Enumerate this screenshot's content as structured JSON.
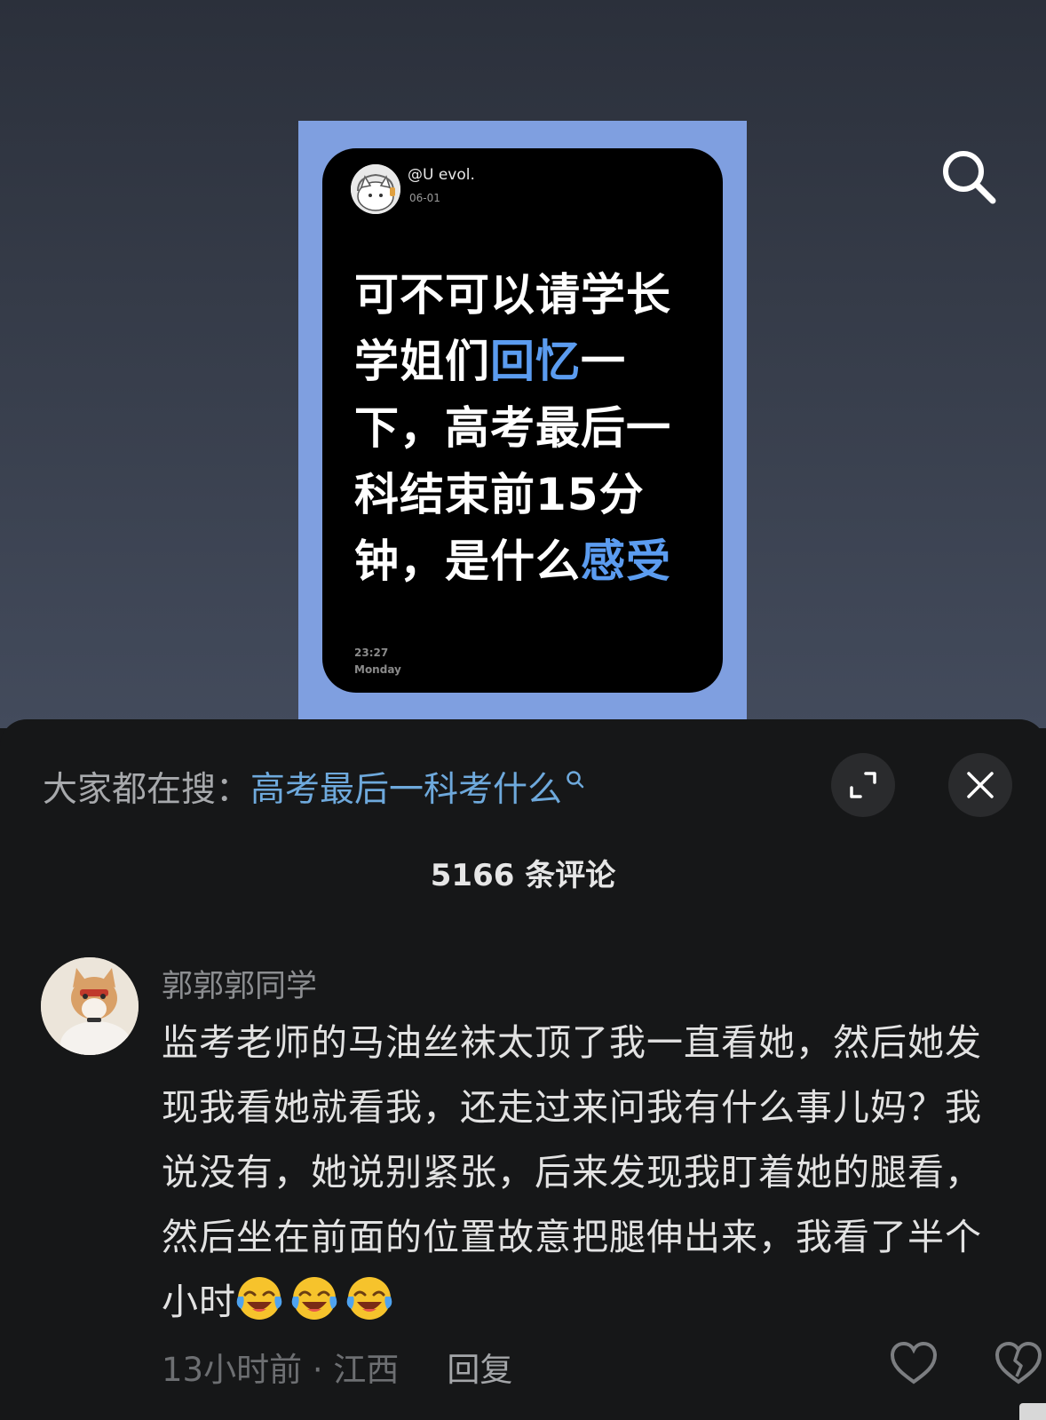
{
  "post": {
    "username": "@U evol.",
    "date": "06-01",
    "text_parts": [
      {
        "t": "可不可以请学长\n学姐们",
        "hl": false
      },
      {
        "t": "回忆",
        "hl": true
      },
      {
        "t": "一\n下，高考最后一\n科结束前15分\n钟，是什么",
        "hl": false
      },
      {
        "t": "感受",
        "hl": true
      }
    ],
    "time": "23:27",
    "day": "Monday"
  },
  "panel": {
    "search_prefix": "大家都在搜：",
    "search_query": "高考最后一科考什么",
    "comment_count": "5166 条评论"
  },
  "comment": {
    "name": "郭郭郭同学",
    "body": "监考老师的马油丝袜太顶了我一直看她，然后她发现我看她就看我，还走过来问我有什么事儿妈？我说没有，她说别紧张，后来发现我盯着她的腿看，然后坐在前面的位置故意把腿伸出来，我看了半个小时",
    "emoji_count": 3,
    "emoji_name": "laughing-tears-emoji",
    "time_location": "13小时前 · 江西",
    "reply_label": "回复"
  },
  "colors": {
    "highlight": "#5b9cf0",
    "query": "#6ea9dc",
    "frame": "#7f9fe0"
  }
}
